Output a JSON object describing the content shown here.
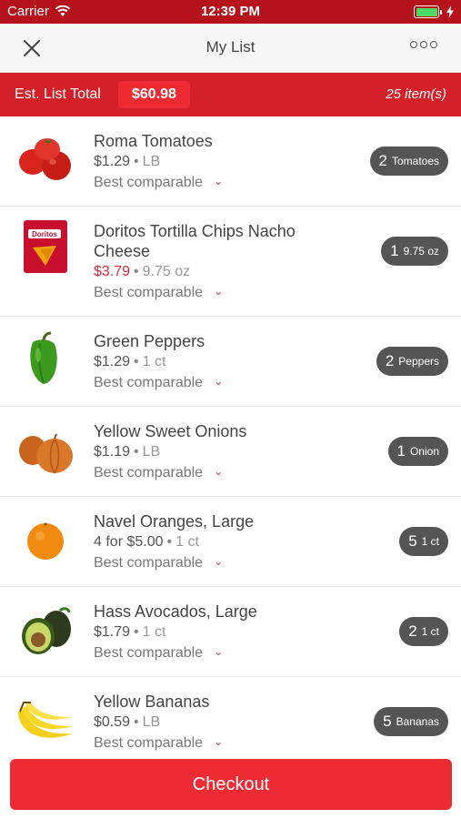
{
  "status": {
    "carrier": "Carrier",
    "time": "12:39 PM"
  },
  "nav": {
    "title": "My List"
  },
  "total": {
    "label": "Est. List Total",
    "amount": "$60.98",
    "count": "25 item(s)"
  },
  "items": [
    {
      "name": "Roma Tomatoes",
      "price": "$1.29",
      "unit": "LB",
      "compare": "Best comparable",
      "qty": "2",
      "qty_unit": "Tomatoes",
      "icon": "tomato-image",
      "sale": false
    },
    {
      "name": "Doritos Tortilla Chips Nacho Cheese",
      "price": "$3.79",
      "unit": "9.75 oz",
      "compare": "Best comparable",
      "qty": "1",
      "qty_unit": "9.75 oz",
      "icon": "chips-bag-image",
      "sale": true
    },
    {
      "name": "Green Peppers",
      "price": "$1.29",
      "unit": "1 ct",
      "compare": "Best comparable",
      "qty": "2",
      "qty_unit": "Peppers",
      "icon": "green-pepper-image",
      "sale": false
    },
    {
      "name": "Yellow Sweet Onions",
      "price": "$1.19",
      "unit": "LB",
      "compare": "Best comparable",
      "qty": "1",
      "qty_unit": "Onion",
      "icon": "onion-image",
      "sale": false
    },
    {
      "name": "Navel Oranges, Large",
      "price": "4 for $5.00",
      "unit": "1 ct",
      "compare": "Best comparable",
      "qty": "5",
      "qty_unit": "1 ct",
      "icon": "orange-image",
      "sale": false
    },
    {
      "name": "Hass Avocados, Large",
      "price": "$1.79",
      "unit": "1 ct",
      "compare": "Best comparable",
      "qty": "2",
      "qty_unit": "1 ct",
      "icon": "avocado-image",
      "sale": false
    },
    {
      "name": "Yellow Bananas",
      "price": "$0.59",
      "unit": "LB",
      "compare": "Best comparable",
      "qty": "5",
      "qty_unit": "Bananas",
      "icon": "banana-image",
      "sale": false
    }
  ],
  "checkout": {
    "label": "Checkout"
  },
  "colors": {
    "brand_red": "#d42028",
    "button_red": "#ee2a33",
    "status_red": "#b5121b",
    "sale_red": "#e0283a"
  }
}
